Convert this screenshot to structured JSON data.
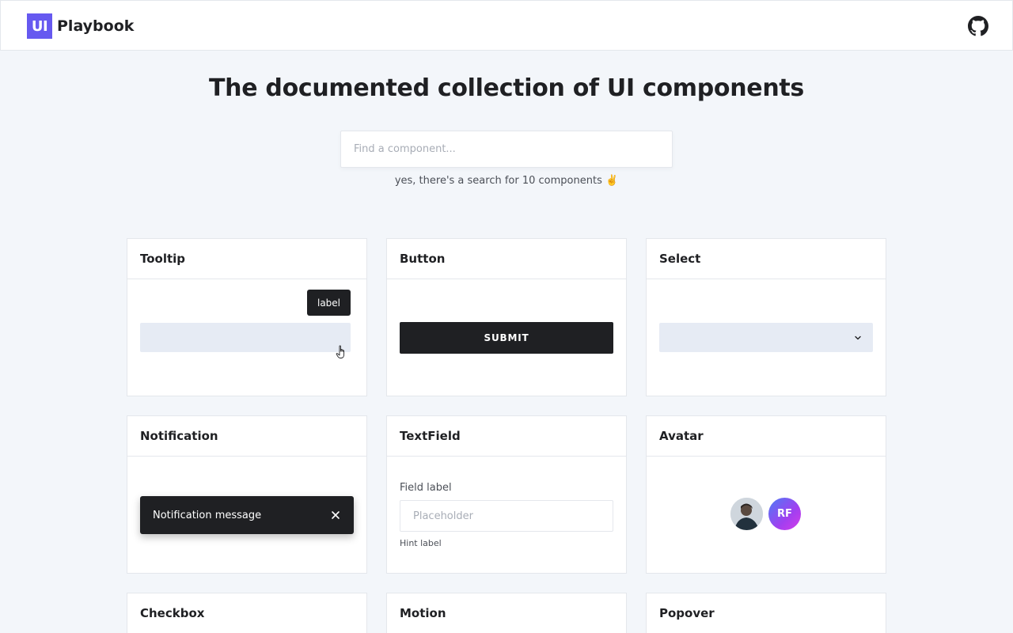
{
  "header": {
    "logo_mark": "UI",
    "logo_text": "Playbook",
    "github_icon": "github-icon"
  },
  "hero": {
    "title": "The documented collection of UI components",
    "search_placeholder": "Find a component...",
    "search_value": "",
    "search_hint": "yes, there's a search for 10 components ✌️"
  },
  "colors": {
    "accent": "#6659f0",
    "dark": "#1f2023",
    "page_bg": "#f3f6fa",
    "placeholder_block": "#e6ebf4"
  },
  "cards": {
    "tooltip": {
      "title": "Tooltip",
      "tooltip_label": "label"
    },
    "button": {
      "title": "Button",
      "button_label": "SUBMIT"
    },
    "select": {
      "title": "Select",
      "selected_value": ""
    },
    "notification": {
      "title": "Notification",
      "message": "Notification message",
      "close_icon": "close-icon"
    },
    "textfield": {
      "title": "TextField",
      "field_label": "Field label",
      "placeholder": "Placeholder",
      "value": "",
      "hint": "Hint label"
    },
    "avatar": {
      "title": "Avatar",
      "initials": "RF"
    },
    "checkbox": {
      "title": "Checkbox"
    },
    "motion": {
      "title": "Motion"
    },
    "popover": {
      "title": "Popover"
    }
  }
}
